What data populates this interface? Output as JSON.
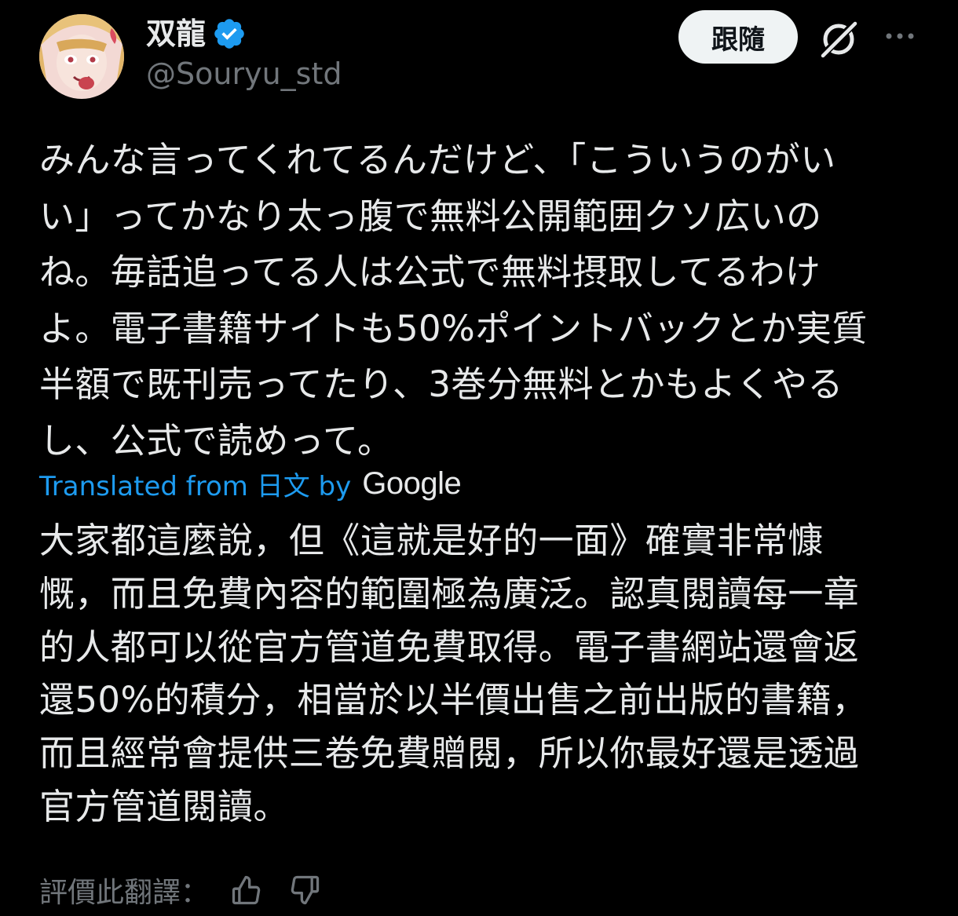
{
  "author": {
    "display_name": "双龍",
    "handle": "@Souryu_std",
    "verified_icon": "verified-badge-icon",
    "avatar_icon": "avatar-image"
  },
  "actions": {
    "follow_label": "跟隨",
    "grok_icon": "grok-icon",
    "more_icon": "more-options-icon"
  },
  "post": {
    "text": "みんな言ってくれてるんだけど、「こういうのがい\nい」ってかなり太っ腹で無料公開範囲クソ広いの\nね。毎話追ってる人は公式で無料摂取してるわけ\nよ。電子書籍サイトも50%ポイントバックとか実質\n半額で既刊売ってたり、3巻分無料とかもよくやる\nし、公式で読めって。"
  },
  "translation": {
    "attribution": "Translated from 日文 by",
    "provider": "Google",
    "text": "大家都這麼說，但《這就是好的一面》確實非常慷\n慨，而且免費內容的範圍極為廣泛。認真閱讀每一章\n的人都可以從官方管道免費取得。電子書網站還會返\n還50%的積分，相當於以半價出售之前出版的書籍，\n而且經常會提供三卷免費贈閱，所以你最好還是透過\n官方管道閱讀。",
    "rate_label": "評價此翻譯：",
    "thumbs_up_icon": "thumbs-up-icon",
    "thumbs_down_icon": "thumbs-down-icon"
  },
  "colors": {
    "background": "#000000",
    "text": "#e7e9ea",
    "muted": "#71767b",
    "accent": "#1d9bf0",
    "follow_bg": "#eff3f4"
  }
}
